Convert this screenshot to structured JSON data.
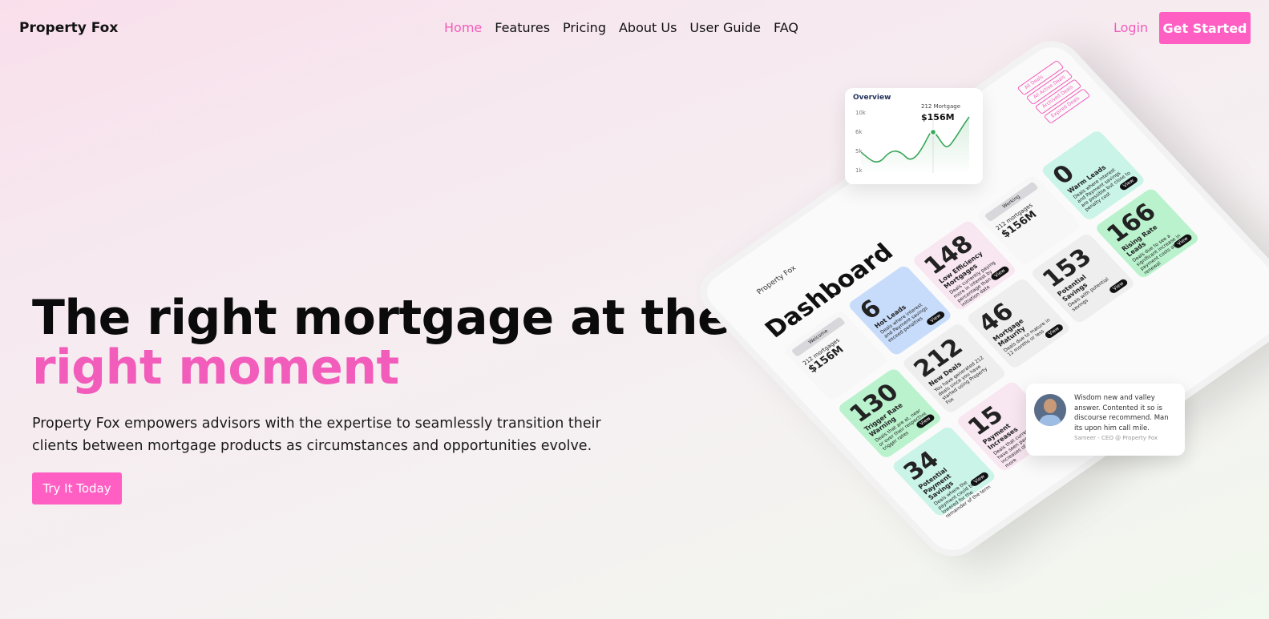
{
  "nav": {
    "brand": "Property Fox",
    "items": [
      {
        "label": "Home",
        "active": true
      },
      {
        "label": "Features"
      },
      {
        "label": "Pricing"
      },
      {
        "label": "About Us"
      },
      {
        "label": "User Guide"
      },
      {
        "label": "FAQ"
      }
    ],
    "login": "Login",
    "get_started": "Get Started"
  },
  "hero": {
    "headline_line1": "The right mortgage at the",
    "headline_line2": "right moment",
    "subtext": "Property Fox empowers advisors with the expertise to seamlessly transition their clients between mortgage products as circumstances and opportunities evolve.",
    "cta": "Try It Today"
  },
  "colors": {
    "accent": "#f25cba",
    "button": "#ff5ec3"
  },
  "mockup": {
    "brand": "Property Fox",
    "title": "Dashboard",
    "side_links": [
      "All Deals",
      "All Active Deals",
      "Archived Deals",
      "Expired Deals"
    ],
    "view_label": "View",
    "cards": [
      {
        "kind": "white",
        "chip": "Welcome",
        "count": "212",
        "unit": "mortgages",
        "amount": "$156M"
      },
      {
        "kind": "blue",
        "number": "6",
        "title": "Hot Leads",
        "desc": "Deals where interest and Payment savings exceed penalties"
      },
      {
        "kind": "pink",
        "number": "148",
        "title": "Low Efficiency Mortgages",
        "desc": "Deals currently paying more in interest by percentage than at initiation date"
      },
      {
        "kind": "white",
        "chip": "Working",
        "count": "212",
        "unit": "mortgages",
        "amount": "$156M"
      },
      {
        "kind": "mint",
        "number": "0",
        "title": "Warm Leads",
        "desc": "Deals where interest and Payment savings are possible but close to penalty cost"
      },
      {
        "kind": "green",
        "number": "130",
        "title": "Trigger Rate Warning",
        "desc": "Deals that are at, near or over their respective trigger rates"
      },
      {
        "kind": "gray",
        "number": "212",
        "title": "New Deals",
        "desc": "You have generated 212 deals since you have started using Property Fox"
      },
      {
        "kind": "gray",
        "number": "46",
        "title": "Mortgage Maturity",
        "desc": "Deals due to mature in 12 months or less"
      },
      {
        "kind": "gray",
        "number": "153",
        "title": "Potential Savings",
        "desc": "Deals with potential savings"
      },
      {
        "kind": "green",
        "number": "166",
        "title": "Rising Rate Leads",
        "desc": "Deals due to see a significant increase in payment costs at renewal"
      },
      {
        "kind": "mint",
        "number": "34",
        "title": "Potential Payment Savings",
        "desc": "Deals where the payment could be lowered for the remainder of the term"
      },
      {
        "kind": "pink",
        "number": "15",
        "title": "Payment Increases",
        "desc": "Deals that currently have seen payment increases of 15% or more"
      }
    ]
  },
  "overview": {
    "title": "Overview",
    "y_ticks": [
      "10k",
      "6k",
      "5k",
      "1k"
    ],
    "mortgage_label": "212 Mortgage",
    "mortgage_value": "$156M"
  },
  "testimonial": {
    "quote": "Wisdom new and valley answer. Contented it so is discourse recommend. Man its upon him call mile.",
    "author": "Sameer - CEO @ Property Fox"
  }
}
